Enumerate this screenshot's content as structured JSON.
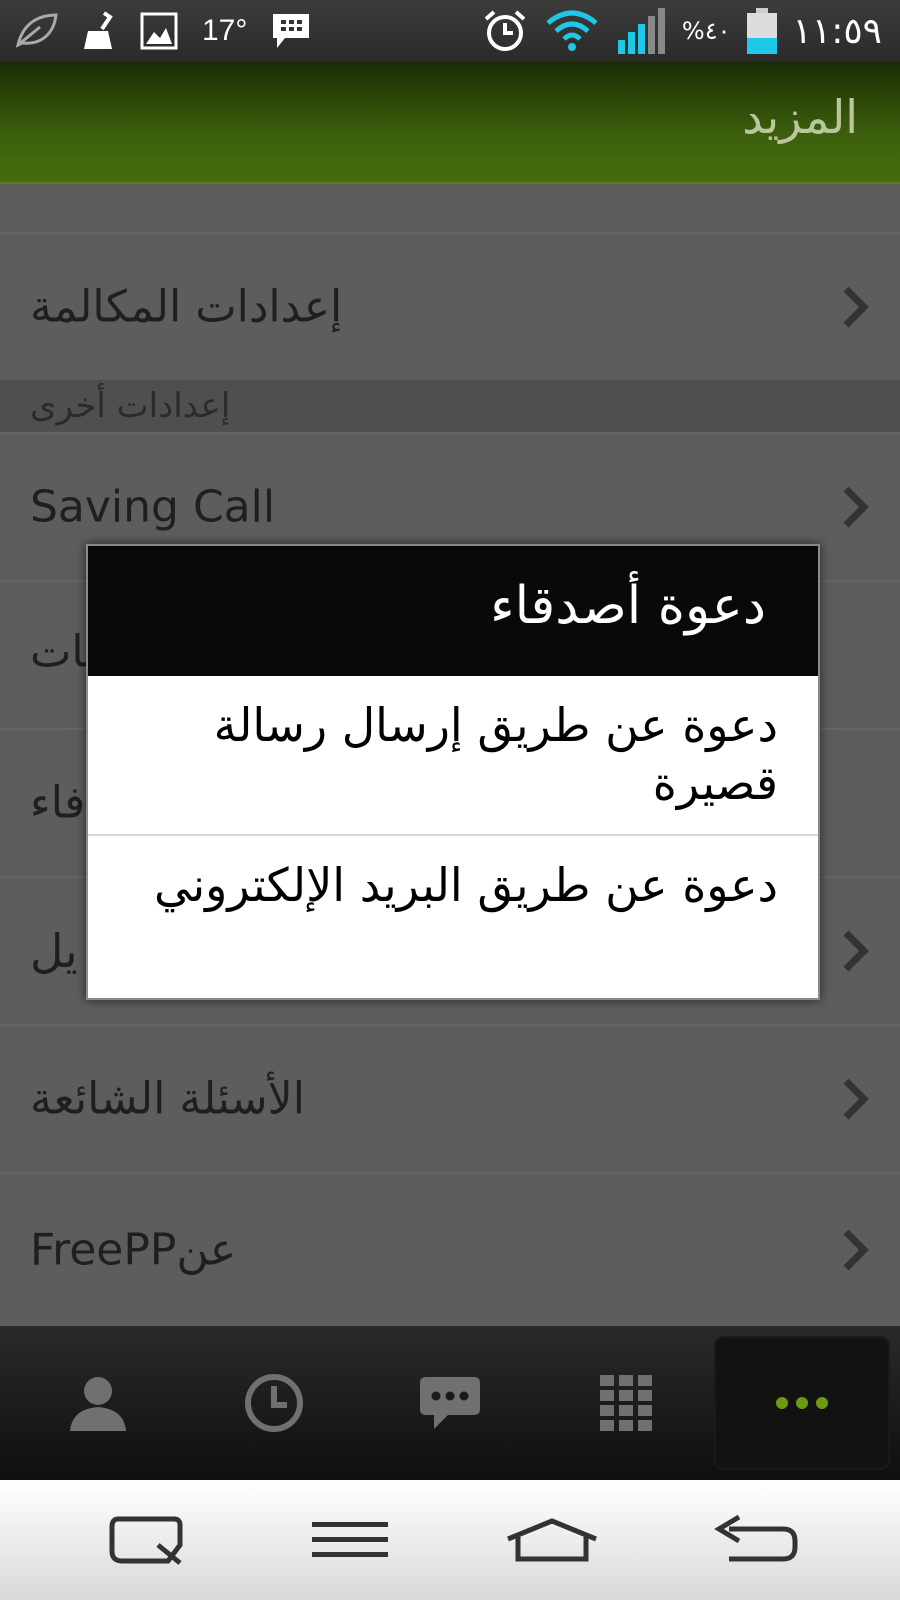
{
  "status_bar": {
    "temperature": "17°",
    "battery_percent": "%٤٠",
    "time": "١١:٥٩",
    "battery_level": 0.4,
    "icons_left": [
      "leaf-icon",
      "cleaner-icon",
      "image-icon",
      "bbm-icon"
    ],
    "icons_right": [
      "alarm-icon",
      "wifi-icon",
      "signal-icon",
      "battery-icon"
    ]
  },
  "header": {
    "title": "المزيد"
  },
  "list": {
    "call_settings": "إعدادات المكالمة",
    "section_other": "إعدادات أخرى",
    "saving_call": "Saving Call",
    "check_updates": "تفحص التحديثات",
    "invite_partial": "فاء",
    "row_partial": "يل",
    "faq": "الأسئلة الشائعة",
    "about": "FreePPعن"
  },
  "dialog": {
    "title": "دعوة أصدقاء",
    "option_sms": "دعوة عن طريق إرسال رسالة قصيرة",
    "option_email": "دعوة عن طريق البريد الإلكتروني"
  },
  "tabs": [
    "contacts-icon",
    "recents-icon",
    "messages-icon",
    "dialpad-icon",
    "more-icon"
  ],
  "nav_buttons": [
    "qslide-icon",
    "menu-icon",
    "home-icon",
    "back-icon"
  ],
  "colors": {
    "header_green": "#3c5f0c",
    "accent_dots": "#6b9a10",
    "wifi_cyan": "#1ec8e6"
  }
}
